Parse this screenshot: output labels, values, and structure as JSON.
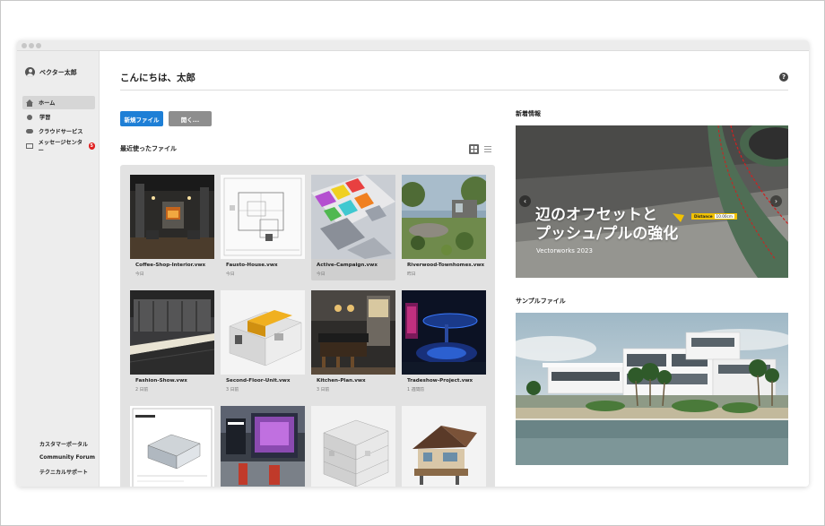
{
  "user": {
    "name": "ベクター太郎"
  },
  "sidebar": {
    "items": [
      {
        "label": "ホーム",
        "icon": "home-icon",
        "active": true
      },
      {
        "label": "学習",
        "icon": "lightbulb-icon",
        "active": false
      },
      {
        "label": "クラウドサービス",
        "icon": "cloud-icon",
        "active": false
      },
      {
        "label": "メッセージセンター",
        "icon": "mail-icon",
        "active": false,
        "badge": "5"
      }
    ],
    "footer": [
      "カスタマーポータル",
      "Community Forum",
      "テクニカルサポート"
    ]
  },
  "main": {
    "greeting": "こんにちは、太郎",
    "help": "?",
    "new_file": "新規ファイル",
    "open": "開く...",
    "recent_title": "最近使ったファイル",
    "files": [
      {
        "name": "Coffee-Shop-Interior.vwx",
        "date": "今日"
      },
      {
        "name": "Fausto-House.vwx",
        "date": "今日"
      },
      {
        "name": "Active-Campaign.vwx",
        "date": "今日"
      },
      {
        "name": "Riverwood-Townhomes.vwx",
        "date": "昨日"
      },
      {
        "name": "Fashion-Show.vwx",
        "date": "2 日前"
      },
      {
        "name": "Second-Floor-Unit.vwx",
        "date": "3 日前"
      },
      {
        "name": "Kitchen-Plan.vwx",
        "date": "3 日前"
      },
      {
        "name": "Tradeshow-Project.vwx",
        "date": "1 週間前"
      },
      {
        "name": "",
        "date": ""
      },
      {
        "name": "",
        "date": ""
      },
      {
        "name": "",
        "date": ""
      },
      {
        "name": "",
        "date": ""
      }
    ]
  },
  "news": {
    "title": "新着情報",
    "headline_line1": "辺のオフセットと",
    "headline_line2": "プッシュ/プルの強化",
    "subtitle": "Vectorworks 2023",
    "tag_label": "Distance",
    "tag_value": "10.00cm"
  },
  "sample": {
    "title": "サンプルファイル"
  }
}
